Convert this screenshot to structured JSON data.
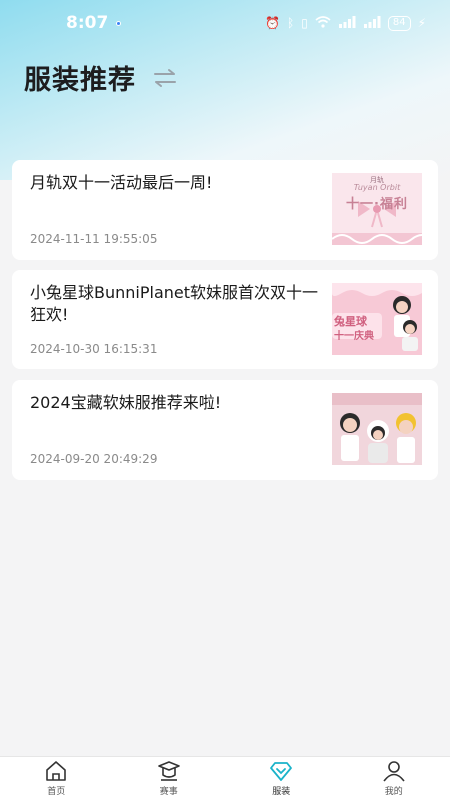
{
  "status_bar": {
    "time": "8:07",
    "battery": "84"
  },
  "header": {
    "title": "服装推荐"
  },
  "articles": [
    {
      "title": "月轨双十一活动最后一周!",
      "time": "2024-11-11 19:55:05",
      "thumb_text": "十一·福利",
      "thumb_caption": "Tuyan Orbit",
      "thumb_brand": "月轨"
    },
    {
      "title": "小兔星球BunniPlanet软妹服首次双十一狂欢!",
      "time": "2024-10-30 16:15:31",
      "thumb_text": "兔星球",
      "thumb_text2": "十一庆典"
    },
    {
      "title": "2024宝藏软妹服推荐来啦!",
      "time": "2024-09-20 20:49:29"
    }
  ],
  "tabbar": {
    "items": [
      {
        "label": "首页",
        "icon": "home-icon"
      },
      {
        "label": "赛事",
        "icon": "graduation-cap-icon"
      },
      {
        "label": "服装",
        "icon": "diamond-icon"
      },
      {
        "label": "我的",
        "icon": "user-icon"
      }
    ],
    "active_color": "#1bb3c9"
  }
}
